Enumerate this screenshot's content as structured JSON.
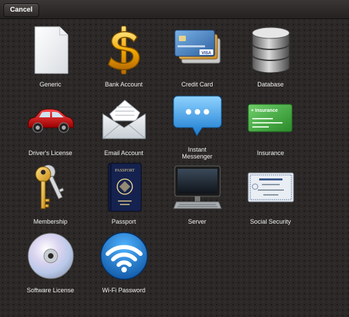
{
  "toolbar": {
    "cancel_label": "Cancel"
  },
  "items": [
    {
      "label": "Generic",
      "icon": "document-icon"
    },
    {
      "label": "Bank Account",
      "icon": "dollar-sign-icon"
    },
    {
      "label": "Credit Card",
      "icon": "credit-card-icon"
    },
    {
      "label": "Database",
      "icon": "database-icon"
    },
    {
      "label": "Driver's License",
      "icon": "car-icon"
    },
    {
      "label": "Email Account",
      "icon": "envelope-icon"
    },
    {
      "label": "Instant\nMessenger",
      "icon": "speech-bubble-icon"
    },
    {
      "label": "Insurance",
      "icon": "insurance-card-icon"
    },
    {
      "label": "Membership",
      "icon": "keys-icon"
    },
    {
      "label": "Passport",
      "icon": "passport-icon"
    },
    {
      "label": "Server",
      "icon": "monitor-icon"
    },
    {
      "label": "Social Security",
      "icon": "social-security-card-icon"
    },
    {
      "label": "Software License",
      "icon": "cd-icon"
    },
    {
      "label": "Wi-Fi Password",
      "icon": "wifi-icon"
    }
  ],
  "icon_text": {
    "card_brand": "VISA",
    "insurance": "+ Insurance",
    "passport": "PASSPORT"
  }
}
